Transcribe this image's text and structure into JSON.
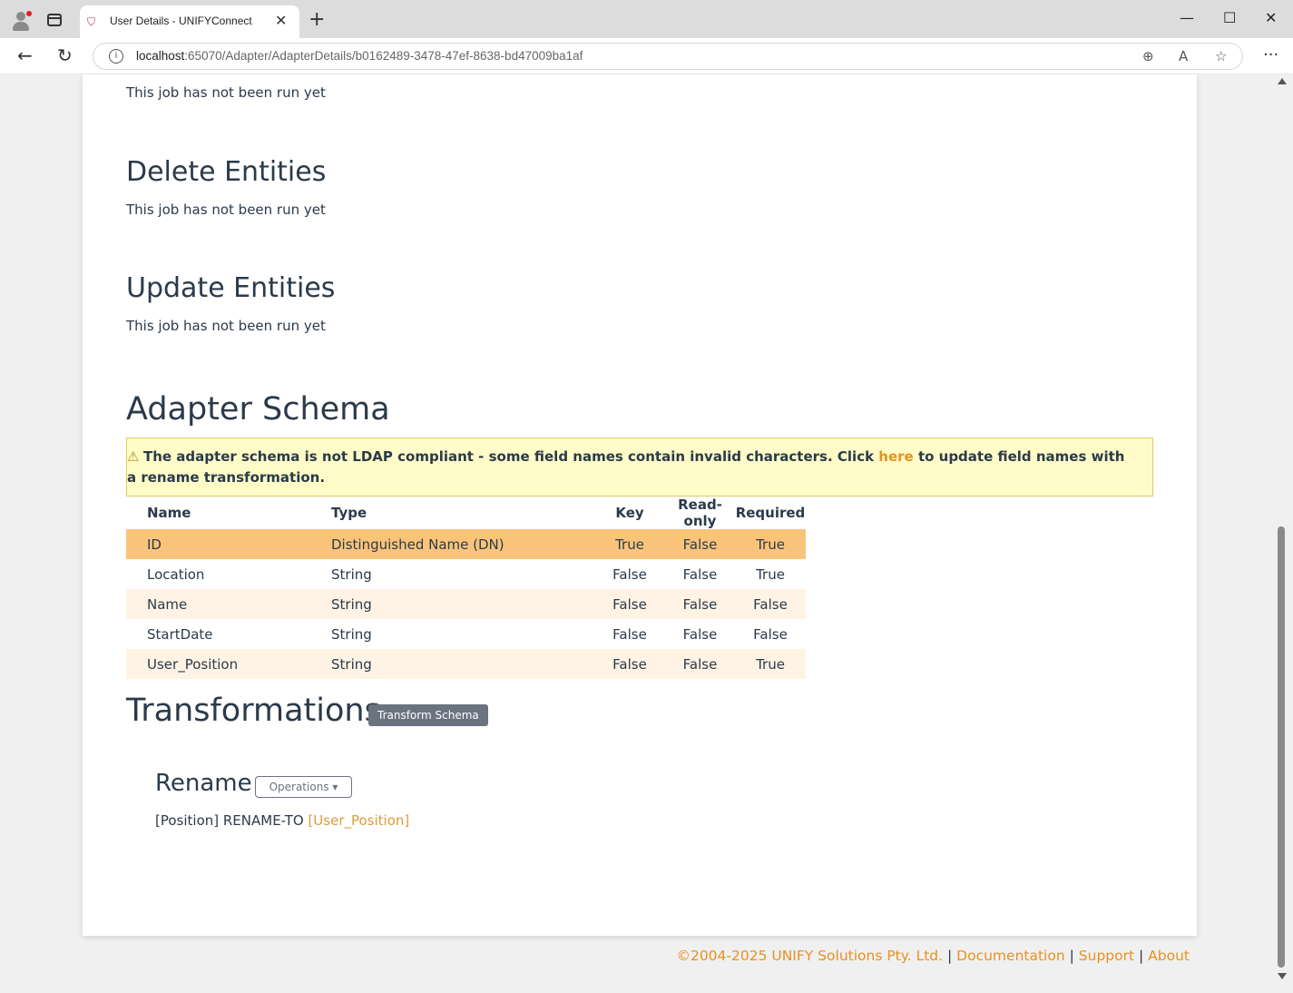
{
  "browser": {
    "tab_title": "User Details - UNIFYConnect",
    "url_host": "localhost",
    "url_rest": ":65070/Adapter/AdapterDetails/b0162489-3478-47ef-8638-bd47009ba1af"
  },
  "jobs": [
    {
      "title": "",
      "status": "This job has not been run yet"
    },
    {
      "title": "Delete Entities",
      "status": "This job has not been run yet"
    },
    {
      "title": "Update Entities",
      "status": "This job has not been run yet"
    }
  ],
  "schema": {
    "title": "Adapter Schema",
    "warning_before": "The adapter schema is not LDAP compliant - some field names contain invalid characters. Click ",
    "warning_link": "here",
    "warning_after": " to update field names with a rename transformation.",
    "headers": {
      "name": "Name",
      "type": "Type",
      "key": "Key",
      "readonly": "Read-only",
      "required": "Required"
    },
    "rows": [
      {
        "name": "ID",
        "type": "Distinguished Name (DN)",
        "key": "True",
        "readonly": "False",
        "required": "True"
      },
      {
        "name": "Location",
        "type": "String",
        "key": "False",
        "readonly": "False",
        "required": "True"
      },
      {
        "name": "Name",
        "type": "String",
        "key": "False",
        "readonly": "False",
        "required": "False"
      },
      {
        "name": "StartDate",
        "type": "String",
        "key": "False",
        "readonly": "False",
        "required": "False"
      },
      {
        "name": "User_Position",
        "type": "String",
        "key": "False",
        "readonly": "False",
        "required": "True"
      }
    ]
  },
  "transformations": {
    "title": "Transformations",
    "transform_button": "Transform Schema",
    "rename_title": "Rename",
    "operations_button": "Operations",
    "rule_text": "[Position] RENAME-TO ",
    "rule_target": "[User_Position]"
  },
  "footer": {
    "copyright": "©2004-2025 UNIFY Solutions Pty. Ltd.",
    "sep": "|",
    "documentation": "Documentation",
    "support": "Support",
    "about": "About"
  },
  "colors": {
    "accent": "#e8911f",
    "selected_row": "#f9c47a",
    "alt_row": "#fff3e5",
    "warning_bg": "#fffcc8"
  }
}
